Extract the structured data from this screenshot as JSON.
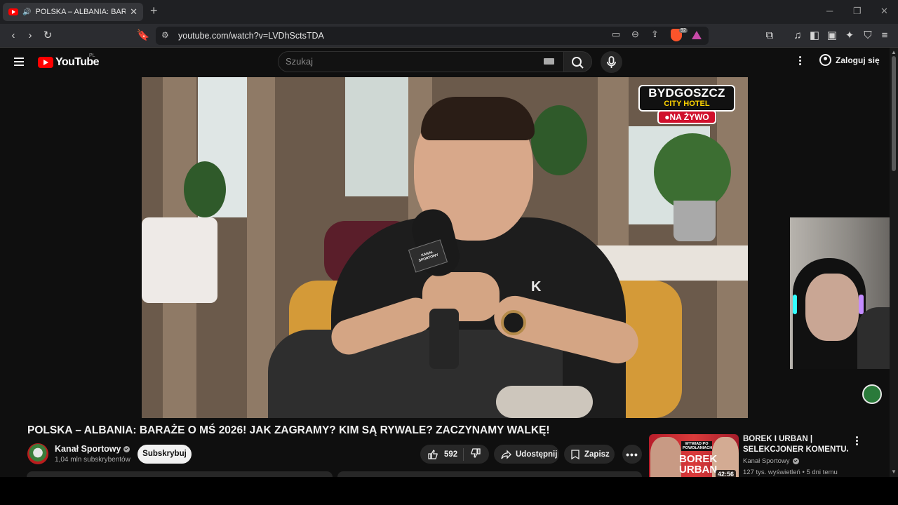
{
  "browser": {
    "tab_title": "POLSKA – ALBANIA: BARAŻE",
    "url": "youtube.com/watch?v=LVDhSctsTDA",
    "brave_shield_count": "92"
  },
  "youtube": {
    "logo_text": "YouTube",
    "country_code": "PL",
    "search_placeholder": "Szukaj",
    "sign_in_label": "Zaloguj się"
  },
  "video": {
    "badge_line1": "BYDGOSZCZ",
    "badge_line2": "CITY HOTEL",
    "live_label": "●NA ŻYWO",
    "mic_tag_text": "KANAŁ SPORTOWY",
    "shirt_logo": "K"
  },
  "watch": {
    "title": "POLSKA – ALBANIA: BARAŻE O MŚ 2026! JAK ZAGRAMY? KIM SĄ RYWALE? ZACZYNAMY WALKĘ!",
    "channel_name": "Kanał Sportowy",
    "subscriber_count": "1,04 mln subskrybentów",
    "subscribe_label": "Subskrybuj",
    "like_count": "592",
    "share_label": "Udostępnij",
    "save_label": "Zapisz"
  },
  "recommendation": {
    "title_line1": "BOREK I URBAN |",
    "title_line2": "SELEKCJONER KOMENTUJE ...",
    "channel": "Kanał Sportowy",
    "meta": "127 tys. wyświetleń • 5 dni temu",
    "duration": "42:56",
    "thumb_tag": "WYWIAD PO POWOŁANIACH",
    "thumb_big_text": "BOREK URBAN"
  },
  "colors": {
    "youtube_red": "#ff0000",
    "background": "#0f0f0f",
    "live_red": "#d0102c",
    "badge_yellow": "#ffd400"
  }
}
